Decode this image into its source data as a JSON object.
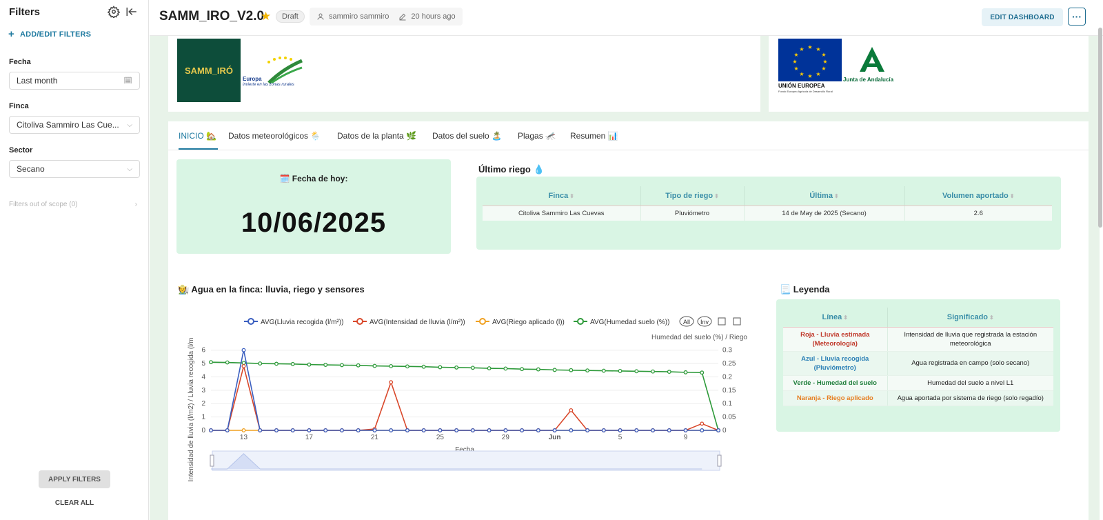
{
  "sidebar": {
    "title": "Filters",
    "add_label": "ADD/EDIT FILTERS",
    "filters": [
      {
        "label": "Fecha",
        "value": "Last month"
      },
      {
        "label": "Finca",
        "value": "Citoliva Sammiro Las Cue..."
      },
      {
        "label": "Sector",
        "value": "Secano"
      }
    ],
    "out_of_scope": "Filters out of scope (0)",
    "apply_label": "APPLY FILTERS",
    "clear_label": "CLEAR ALL"
  },
  "header": {
    "title": "SAMM_IRO_V2.0",
    "status": "Draft",
    "owner": "sammiro sammiro",
    "modified": "20 hours ago",
    "edit_label": "EDIT DASHBOARD",
    "more_label": "···"
  },
  "logos": {
    "samm": "SAMM_IRÓ",
    "europa": "Europa",
    "europa_sub": "invierte en las zonas rurales",
    "eu": "UNIÓN EUROPEA",
    "eu_sub": "Fondo Europeo Agrícola de Desarrollo Rural",
    "ja": "Junta de Andalucía"
  },
  "tabs": [
    {
      "label": "INICIO 🏡"
    },
    {
      "label": "Datos meteorológicos 🌦️"
    },
    {
      "label": "Datos de la planta 🌿"
    },
    {
      "label": "Datos del suelo 🏝️"
    },
    {
      "label": "Plagas 🦟"
    },
    {
      "label": "Resumen 📊"
    }
  ],
  "fecha": {
    "label": "🗓️ Fecha de hoy:",
    "value": "10/06/2025"
  },
  "ultimo_riego": {
    "title": "Último riego 💧",
    "columns": [
      "Finca",
      "Tipo de riego",
      "Última",
      "Volumen aportado"
    ],
    "rows": [
      [
        "Citoliva Sammiro Las Cuevas",
        "Pluviómetro",
        "14 de May de 2025 (Secano)",
        "2.6"
      ]
    ]
  },
  "chart_title": "🧑‍🌾 Agua en la finca: lluvia, riego y sensores",
  "chart_data": {
    "type": "line",
    "xlabel": "Fecha",
    "ylabel": "Intensidad de lluvia (l/m2) / Lluvia recogida (l/m",
    "y2label": "Humedad del suelo (%) / Riego",
    "x": [
      11,
      12,
      13,
      14,
      15,
      16,
      17,
      18,
      19,
      20,
      21,
      22,
      23,
      24,
      25,
      26,
      27,
      28,
      29,
      30,
      31,
      32,
      33,
      34,
      35,
      36,
      37,
      38,
      39,
      40,
      41
    ],
    "x_ticks": [
      {
        "x": 13,
        "label": "13"
      },
      {
        "x": 17,
        "label": "17"
      },
      {
        "x": 21,
        "label": "21"
      },
      {
        "x": 25,
        "label": "25"
      },
      {
        "x": 29,
        "label": "29"
      },
      {
        "x": 32,
        "label": "Jun"
      },
      {
        "x": 36,
        "label": "5"
      },
      {
        "x": 40,
        "label": "9"
      }
    ],
    "ylim": [
      0,
      6.5
    ],
    "y2lim": [
      0,
      0.325
    ],
    "y_ticks": [
      0,
      1,
      2,
      3,
      4,
      5,
      6
    ],
    "y2_ticks": [
      "0",
      "0.05",
      "0.1",
      "0.15",
      "0.2",
      "0.25",
      "0.3"
    ],
    "legend_buttons": [
      "All",
      "Inv"
    ],
    "series": [
      {
        "name": "AVG(Lluvia recogida (l/m²))",
        "color": "#3b5fc0",
        "axis": "left",
        "values": [
          0,
          0,
          6,
          0,
          0,
          0,
          0,
          0,
          0,
          0,
          0,
          0,
          0,
          0,
          0,
          0,
          0,
          0,
          0,
          0,
          0,
          0,
          0,
          0,
          0,
          0,
          0,
          0,
          0,
          0,
          0
        ]
      },
      {
        "name": "AVG(Intensidad de lluvia (l/m²))",
        "color": "#d9482b",
        "axis": "left",
        "values": [
          0,
          0,
          4.8,
          0,
          0,
          0,
          0,
          0,
          0,
          0,
          0.1,
          3.6,
          0,
          0,
          0,
          0,
          0,
          0,
          0,
          0,
          0,
          0,
          1.5,
          0,
          0,
          0,
          0,
          0,
          0,
          0,
          0.5
        ]
      },
      {
        "name": "AVG(Riego aplicado (l))",
        "color": "#f0a020",
        "axis": "left",
        "values": [
          0,
          0,
          0,
          0,
          0,
          0,
          0,
          0,
          0,
          0,
          0,
          0,
          0,
          0,
          0,
          0,
          0,
          0,
          0,
          0,
          0,
          0,
          0,
          0,
          0,
          0,
          0,
          0,
          0,
          0,
          0
        ]
      },
      {
        "name": "AVG(Humedad suelo (%))",
        "color": "#2e9a3a",
        "axis": "right",
        "values": [
          0.255,
          0.254,
          0.252,
          0.25,
          0.249,
          0.248,
          0.246,
          0.245,
          0.244,
          0.243,
          0.241,
          0.24,
          0.239,
          0.238,
          0.236,
          0.235,
          0.234,
          0.232,
          0.231,
          0.229,
          0.228,
          0.226,
          0.225,
          0.224,
          0.223,
          0.222,
          0.221,
          0.22,
          0.219,
          0.217,
          0.216
        ]
      }
    ],
    "extra_point": {
      "x": 42,
      "values": [
        0,
        0,
        0,
        0
      ]
    }
  },
  "leyenda": {
    "title": "📃 Leyenda",
    "columns": [
      "Línea",
      "Significado"
    ],
    "rows": [
      {
        "line": "Roja - Lluvia estimada (Meteorología)",
        "color": "#c0392b",
        "meaning": "Intensidad de lluvia que registrada la estación meteorológica"
      },
      {
        "line": "Azul - Lluvia recogida (Pluviómetro)",
        "color": "#2a7fb5",
        "meaning": "Agua registrada en campo (solo secano)"
      },
      {
        "line": "Verde - Humedad del suelo",
        "color": "#1e7d3a",
        "meaning": "Humedad del suelo a nivel L1"
      },
      {
        "line": "Naranja - Riego aplicado",
        "color": "#e67e22",
        "meaning": "Agua aportada por sistema de riego (solo regadío)"
      }
    ]
  }
}
